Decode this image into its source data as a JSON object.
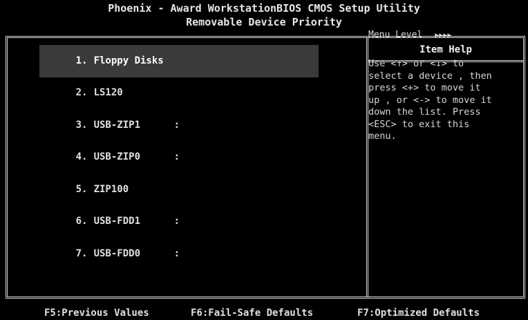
{
  "header": {
    "title": "Phoenix - Award WorkstationBIOS CMOS Setup Utility",
    "subtitle": "Removable Device Priority"
  },
  "devices": [
    {
      "num": "1.",
      "name": "Floppy Disks",
      "suffix": ""
    },
    {
      "num": "2.",
      "name": "LS120",
      "suffix": ""
    },
    {
      "num": "3.",
      "name": "USB-ZIP1",
      "suffix": ":"
    },
    {
      "num": "4.",
      "name": "USB-ZIP0",
      "suffix": ":"
    },
    {
      "num": "5.",
      "name": "ZIP100",
      "suffix": ""
    },
    {
      "num": "6.",
      "name": "USB-FDD1",
      "suffix": ":"
    },
    {
      "num": "7.",
      "name": "USB-FDD0",
      "suffix": ":"
    }
  ],
  "selected_index": 0,
  "help": {
    "title": "Item Help",
    "menu_level_label": "Menu Level",
    "menu_level_arrows": "▶▶▶▶",
    "text": "Use <↑> or <↓> to\nselect a device , then\npress <+> to move it\nup , or <-> to move it\ndown the list. Press\n<ESC> to exit this\nmenu."
  },
  "footer": {
    "f5": "F5:Previous Values",
    "f6": "F6:Fail-Safe Defaults",
    "f7": "F7:Optimized Defaults"
  }
}
